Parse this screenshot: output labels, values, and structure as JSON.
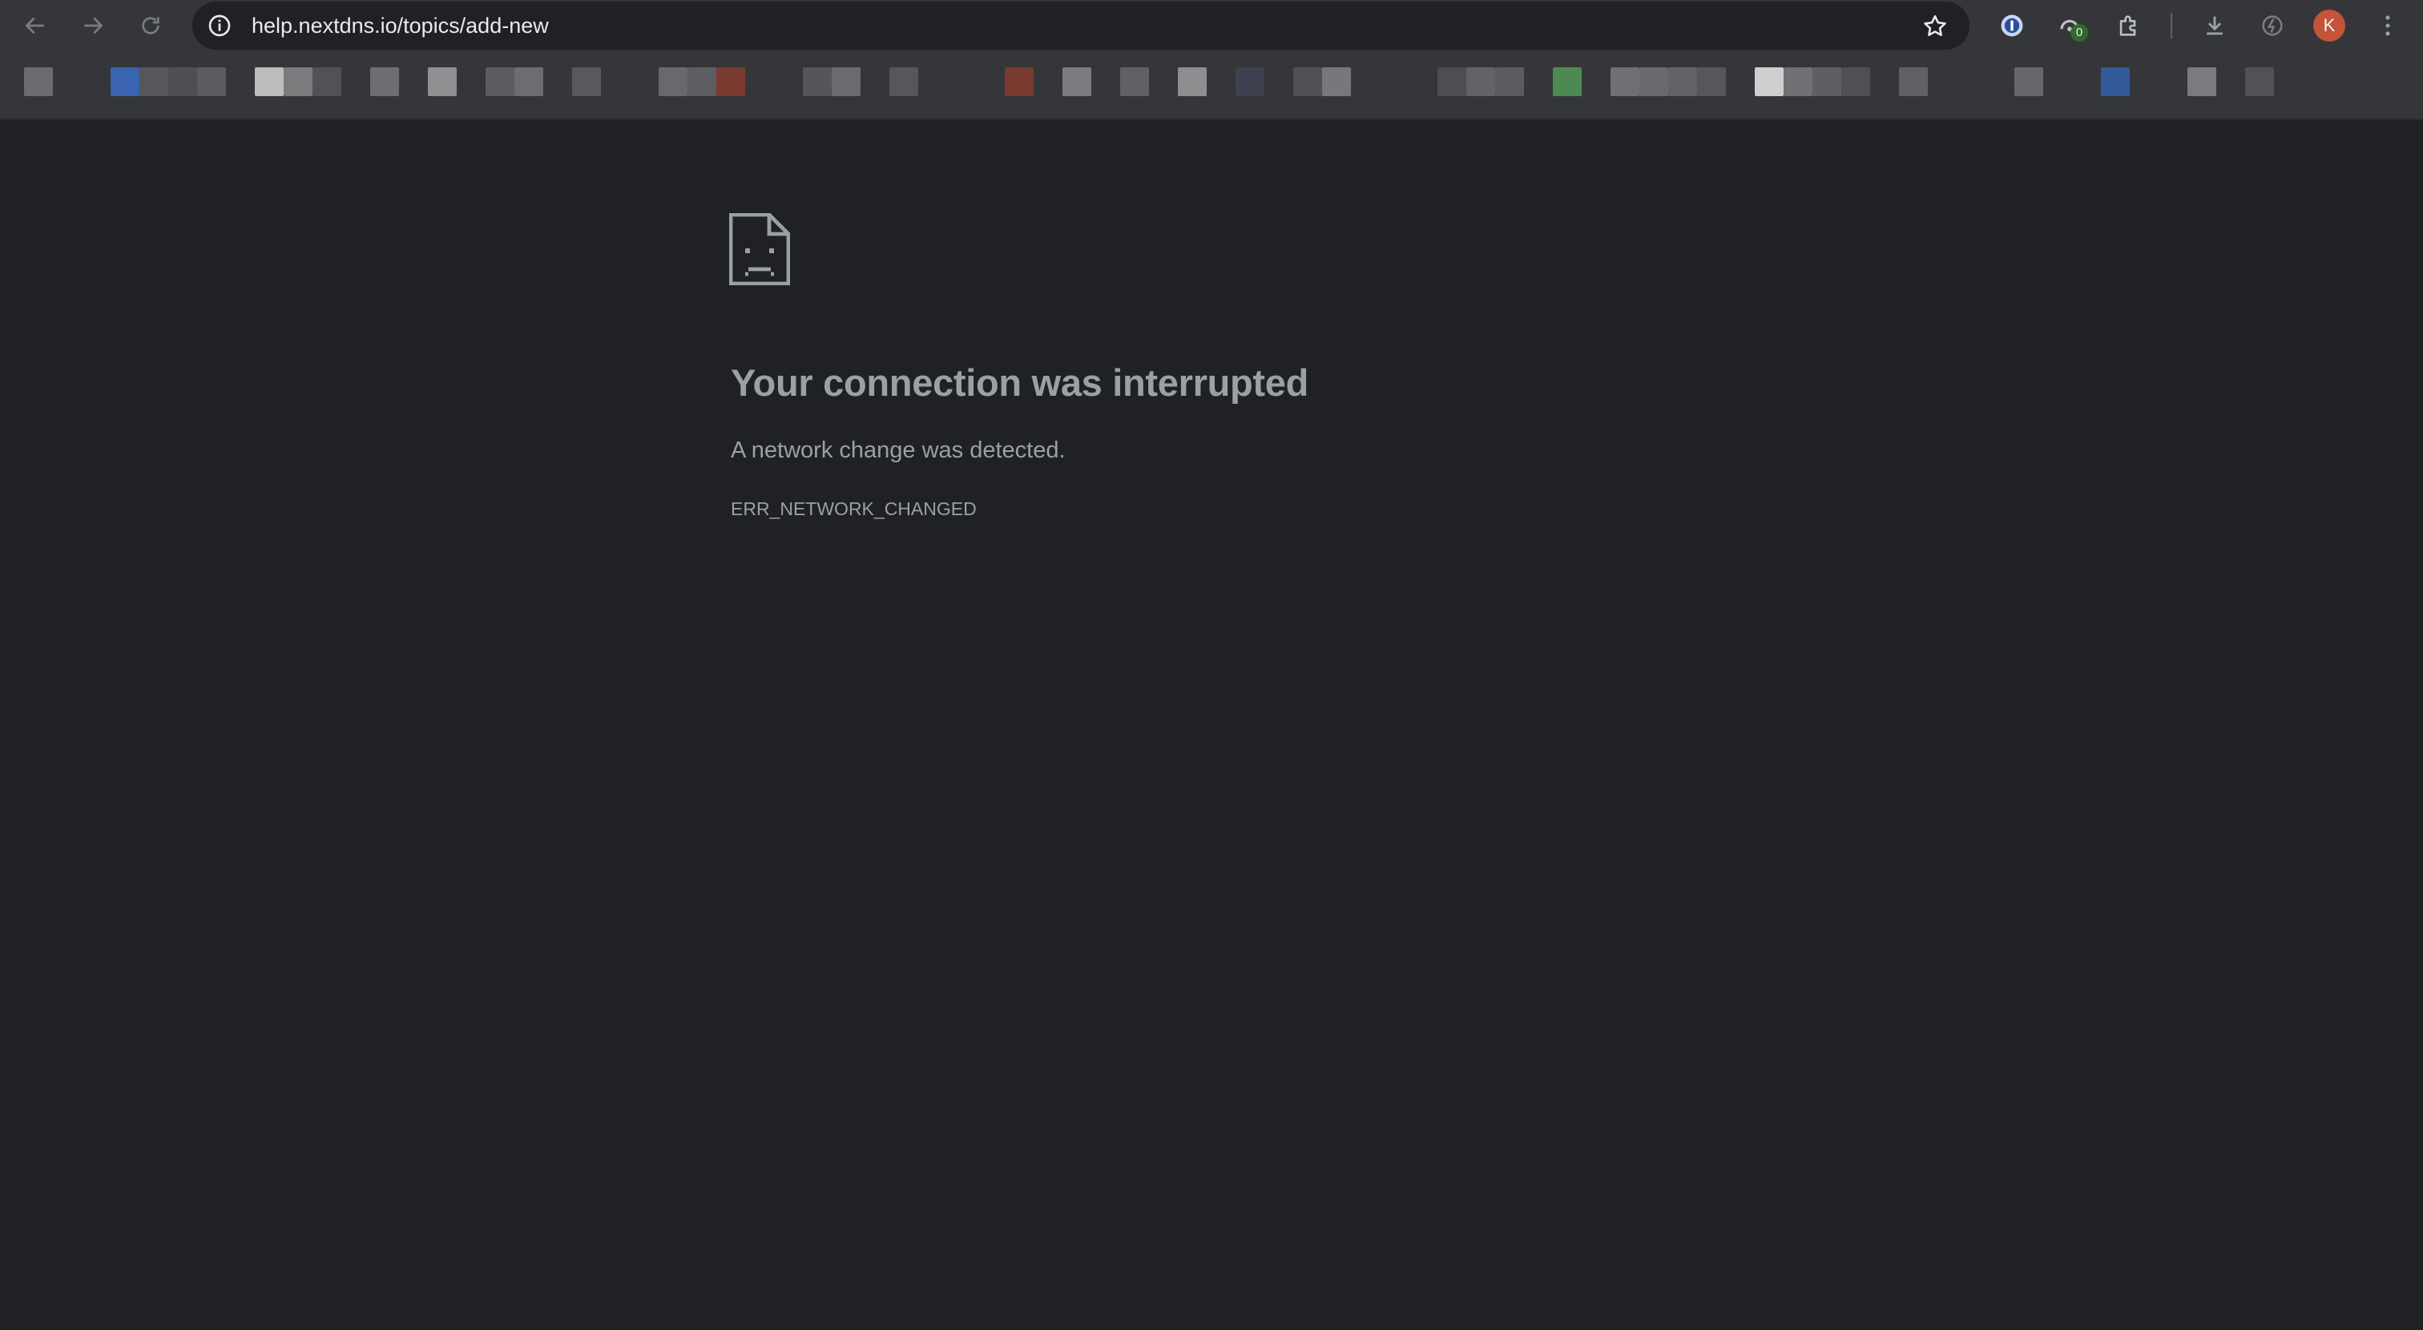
{
  "browser": {
    "address_bar": {
      "url": "help.nextdns.io/topics/add-new"
    },
    "extensions": {
      "badge_count": "0"
    },
    "profile": {
      "initial": "K",
      "color": "#c4533a"
    }
  },
  "error_page": {
    "title": "Your connection was interrupted",
    "message": "A network change was detected.",
    "error_code": "ERR_NETWORK_CHANGED",
    "icon": "sad-page-icon"
  },
  "colors": {
    "page_background": "#202124",
    "toolbar_background": "#35363a",
    "omnibox_background": "#202124",
    "error_text": "#9aa0a6"
  }
}
